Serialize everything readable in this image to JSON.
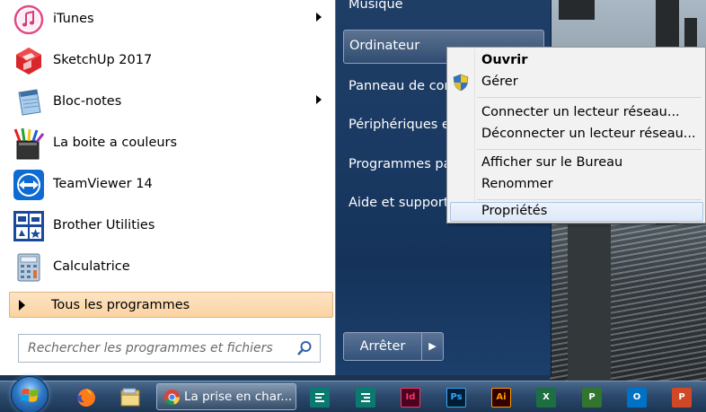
{
  "start_menu": {
    "programs": [
      {
        "label": "iTunes",
        "icon": "itunes-icon",
        "has_submenu": true
      },
      {
        "label": "SketchUp 2017",
        "icon": "sketchup-icon",
        "has_submenu": false
      },
      {
        "label": "Bloc-notes",
        "icon": "notepad-icon",
        "has_submenu": true
      },
      {
        "label": "La boite a couleurs",
        "icon": "paint-box-icon",
        "has_submenu": false
      },
      {
        "label": "TeamViewer 14",
        "icon": "teamviewer-icon",
        "has_submenu": false
      },
      {
        "label": "Brother Utilities",
        "icon": "brother-utilities-icon",
        "has_submenu": false
      },
      {
        "label": "Calculatrice",
        "icon": "calculator-icon",
        "has_submenu": false
      }
    ],
    "all_programs_label": "Tous les programmes",
    "search_placeholder": "Rechercher les programmes et fichiers",
    "right_items": {
      "music": "Musique",
      "computer": "Ordinateur",
      "control_panel": "Panneau de configuration",
      "devices": "Périphériques et imprimantes",
      "default_programs": "Programmes par défaut",
      "help": "Aide et support"
    },
    "shutdown_label": "Arrêter"
  },
  "context_menu": {
    "open": "Ouvrir",
    "manage": "Gérer",
    "map_drive": "Connecter un lecteur réseau...",
    "disconnect_drive": "Déconnecter un lecteur réseau...",
    "show_desktop": "Afficher sur le Bureau",
    "rename": "Renommer",
    "properties": "Propriétés"
  },
  "taskbar": {
    "chrome_task_label": "La prise en char...",
    "pinned": [
      "firefox-icon",
      "file-explorer-icon",
      "chrome-icon",
      "sway-icon",
      "sway-icon",
      "indesign-icon",
      "photoshop-icon",
      "illustrator-icon",
      "excel-icon",
      "project-icon",
      "outlook-icon",
      "powerpoint-icon"
    ],
    "icon_text": {
      "indesign": "Id",
      "photoshop": "Ps",
      "illustrator": "Ai",
      "excel": "X",
      "project": "P",
      "outlook": "O",
      "powerpoint": "P"
    }
  },
  "colors": {
    "start_pane_blue": "#1a3a63",
    "all_programs_highlight": "#fbd3a2",
    "menu_highlight": "#dde8f8"
  }
}
